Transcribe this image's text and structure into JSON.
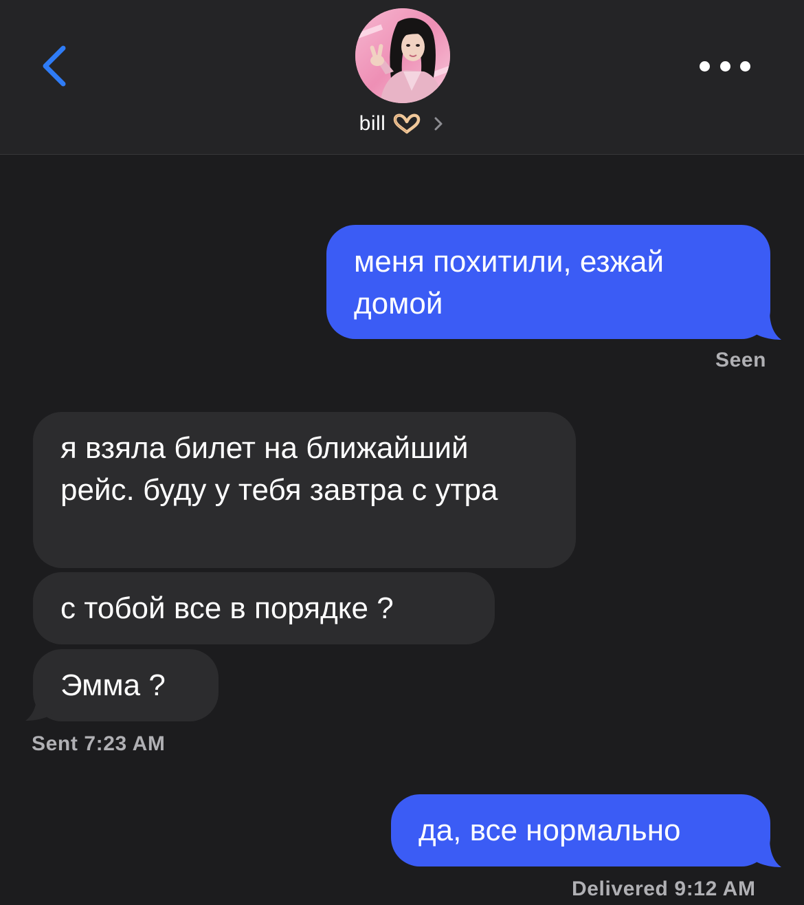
{
  "header": {
    "contact_name": "bill",
    "contact_emoji": "heart-hands-icon",
    "avatar": "profile-photo"
  },
  "messages": [
    {
      "direction": "sent",
      "text": "меня похитили, езжай домой"
    },
    {
      "direction": "received",
      "text": "я взяла билет на ближайший рейс. буду у тебя завтра с утра"
    },
    {
      "direction": "received",
      "text": "с тобой все в порядке ?"
    },
    {
      "direction": "received",
      "text": "Эмма ?"
    },
    {
      "direction": "sent",
      "text": "да, все нормально"
    }
  ],
  "status": {
    "seen": "Seen",
    "sent_time": "Sent 7:23 AM",
    "delivered": "Delivered 9:12 AM"
  },
  "colors": {
    "background": "#1c1c1e",
    "header_background": "#242426",
    "sent_bubble": "#3b5cf5",
    "received_bubble": "#2c2c2e",
    "accent": "#2f7cf6"
  }
}
